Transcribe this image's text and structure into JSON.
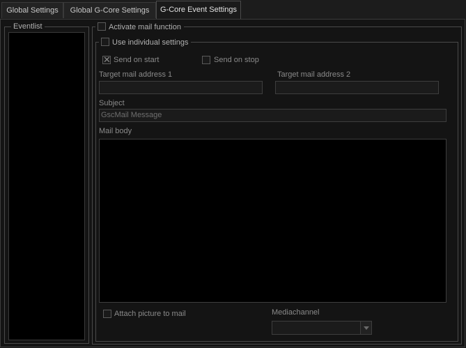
{
  "tabs": [
    {
      "label": "Global Settings"
    },
    {
      "label": "Global G-Core Settings"
    },
    {
      "label": "G-Core Event Settings"
    }
  ],
  "eventlist": {
    "legend": "Eventlist"
  },
  "mail": {
    "activate_label": "Activate mail function",
    "activate_checked": false,
    "individual_label": "Use individual settings",
    "individual_checked": false,
    "send_on_start_label": "Send on start",
    "send_on_start_checked": true,
    "send_on_stop_label": "Send on stop",
    "send_on_stop_checked": false,
    "target1_label": "Target mail address 1",
    "target1_value": "",
    "target2_label": "Target mail address 2",
    "target2_value": "",
    "subject_label": "Subject",
    "subject_value": "GscMail Message",
    "body_label": "Mail body",
    "body_value": "",
    "attach_label": "Attach picture to mail",
    "attach_checked": false,
    "mediachannel_label": "Mediachannel",
    "mediachannel_value": ""
  },
  "icons": {
    "check": "check-x-icon",
    "dropdown": "chevron-down-icon"
  }
}
